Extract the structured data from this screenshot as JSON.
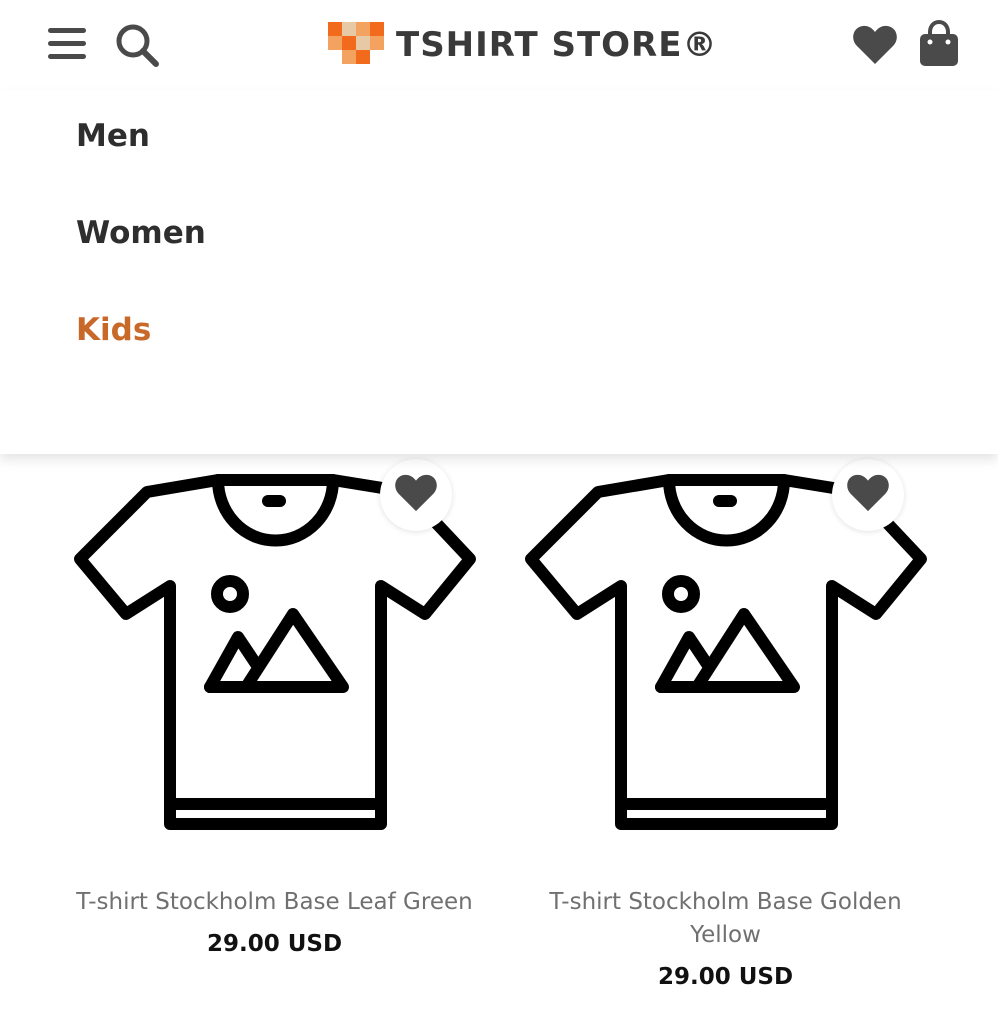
{
  "header": {
    "brand_name": "TSHIRT STORE®",
    "icons": {
      "menu": "menu-icon",
      "search": "search-icon",
      "wishlist": "heart-icon",
      "cart": "shopping-bag-icon"
    },
    "logo_colors": [
      "#f26b1d",
      "#f4a25f",
      "#e8c9a5"
    ]
  },
  "menu": {
    "items": [
      {
        "label": "Men",
        "active": false
      },
      {
        "label": "Women",
        "active": false
      },
      {
        "label": "Kids",
        "active": true
      }
    ],
    "active_color": "#c8692a"
  },
  "products": [
    {
      "name": "T-shirt Stockholm Base Leaf Green",
      "price": "29.00 USD",
      "image": "tshirt-placeholder-icon"
    },
    {
      "name": "T-shirt Stockholm Base Golden Yellow",
      "price": "29.00 USD",
      "image": "tshirt-placeholder-icon"
    }
  ]
}
